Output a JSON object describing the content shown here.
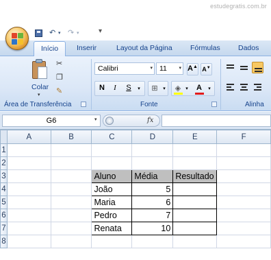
{
  "watermark": "estudegratis.com.br",
  "ribbon": {
    "tabs": [
      {
        "label": "Início",
        "active": true
      },
      {
        "label": "Inserir",
        "active": false
      },
      {
        "label": "Layout da Página",
        "active": false
      },
      {
        "label": "Fórmulas",
        "active": false
      },
      {
        "label": "Dados",
        "active": false
      }
    ],
    "clipboard": {
      "paste_label": "Colar",
      "group_label": "Área de Transferência"
    },
    "font": {
      "name": "Calibri",
      "size": "11",
      "bold": "N",
      "italic": "I",
      "underline": "S",
      "group_label": "Fonte"
    },
    "alignment": {
      "group_label": "Alinha"
    }
  },
  "formula_bar": {
    "name_box": "G6",
    "fx_label": "fx",
    "formula": ""
  },
  "sheet": {
    "columns": [
      "A",
      "B",
      "C",
      "D",
      "E",
      "F"
    ],
    "rows": [
      "1",
      "2",
      "3",
      "4",
      "5",
      "6",
      "7",
      "8"
    ],
    "table": {
      "headers": [
        "Aluno",
        "Média",
        "Resultado"
      ],
      "records": [
        {
          "aluno": "João",
          "media": "5",
          "resultado": ""
        },
        {
          "aluno": "Maria",
          "media": "6",
          "resultado": ""
        },
        {
          "aluno": "Pedro",
          "media": "7",
          "resultado": ""
        },
        {
          "aluno": "Renata",
          "media": "10",
          "resultado": ""
        }
      ]
    }
  },
  "colors": {
    "header_fill": "#bfbfbf",
    "accent": "#15428b",
    "active_tab_bg": "#ffffff"
  }
}
